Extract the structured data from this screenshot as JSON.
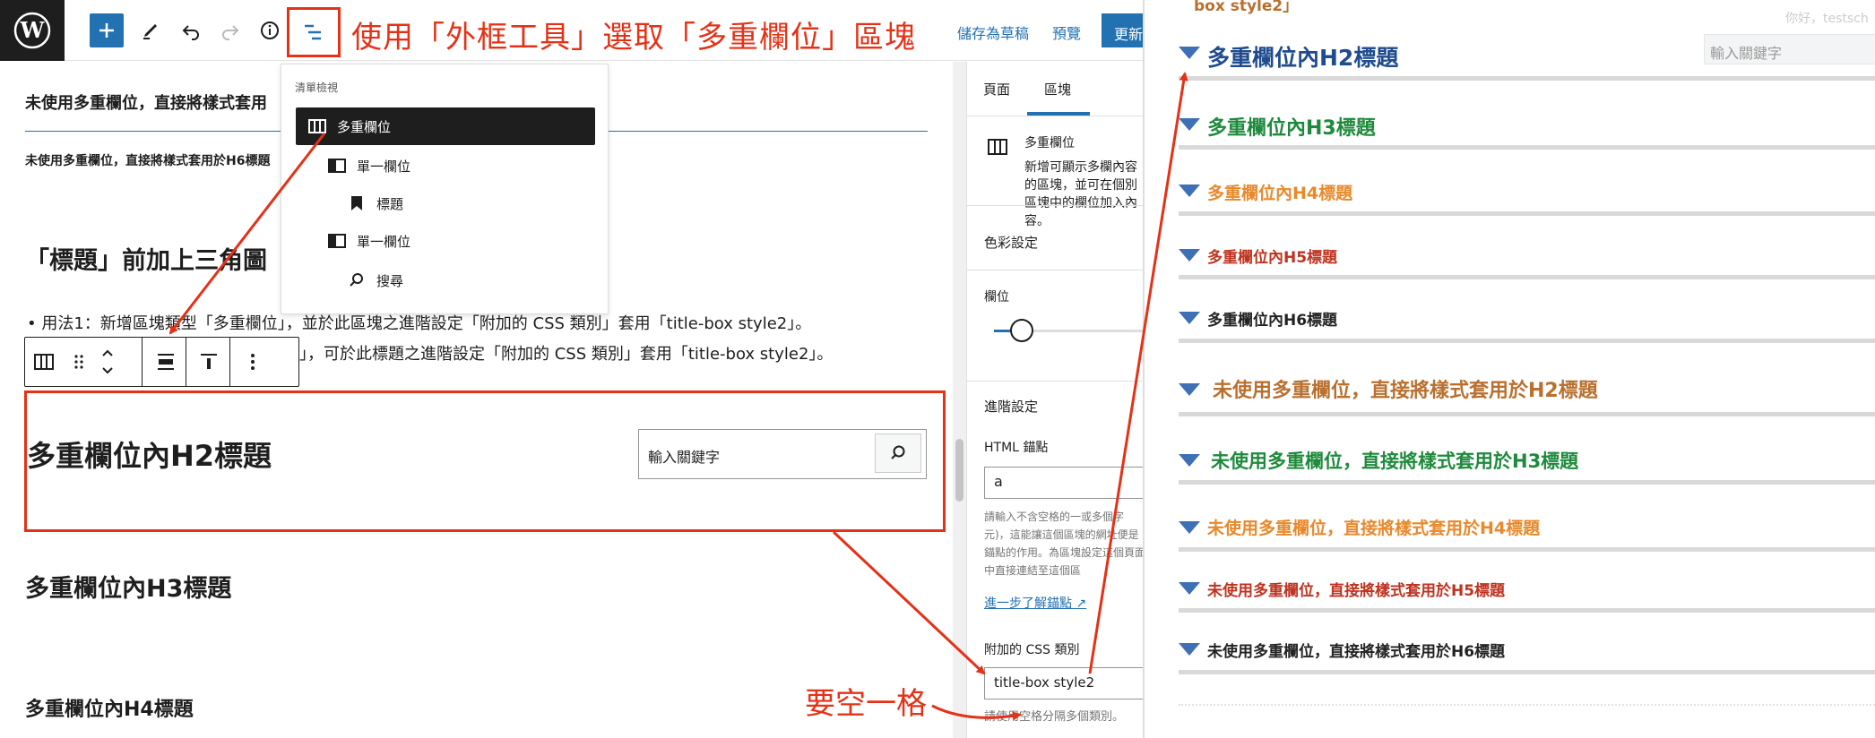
{
  "toolbar": {
    "save_draft": "儲存為草稿",
    "preview": "預覽",
    "update": "更新"
  },
  "annotations": {
    "title": "使用「外框工具」選取「多重欄位」區塊",
    "space_note": "要空一格"
  },
  "list_view": {
    "title": "清單檢視",
    "items": [
      {
        "label": "多重欄位",
        "active": true
      },
      {
        "label": "單一欄位"
      },
      {
        "label": "標題"
      },
      {
        "label": "單一欄位"
      },
      {
        "label": "搜尋"
      }
    ]
  },
  "canvas": {
    "heading_top": "未使用多重欄位，直接將樣式套用",
    "heading_small": "未使用多重欄位，直接將樣式套用於H6標題",
    "section_heading": "「標題」前加上三角圖",
    "bullet1": "用法1：新增區塊類型「多重欄位」，並於此區塊之進階設定「附加的 CSS 類別」套用「title-box style2」。",
    "bullet2": "」，可於此標題之進階設定「附加的 CSS 類別」套用「title-box style2」。",
    "block_h2": "多重欄位內H2標題",
    "search_placeholder": "輸入關鍵字",
    "block_h3": "多重欄位內H3標題",
    "block_h4": "多重欄位內H4標題"
  },
  "sidebar": {
    "tab_page": "頁面",
    "tab_block": "區塊",
    "block_name": "多重欄位",
    "block_desc": "新增可顯示多欄內容的區塊，並可在個別區塊中的欄位加入內容。",
    "color_settings": "色彩設定",
    "columns_label": "欄位",
    "advanced": "進階設定",
    "html_anchor_label": "HTML 錨點",
    "html_anchor_value": "a",
    "anchor_help": "請輸入不含空格的一或多個字元)，這能讓這個區塊的網址便是錨點的作用。為區塊設定這個頁面中直接連結至這個區",
    "learn_more": "進一步了解錨點",
    "css_class_label": "附加的 CSS 類別",
    "css_class_value": "title-box style2",
    "css_class_help": "請使用空格分隔多個類別。"
  },
  "preview": {
    "top_cut": "box style2」",
    "greeting": "你好，testsch",
    "search_placeholder": "輸入關鍵字",
    "headings": [
      {
        "text": "多重欄位內H2標題",
        "color": "#1f4b8f"
      },
      {
        "text": "多重欄位內H3標題",
        "color": "#1e8a3c"
      },
      {
        "text": "多重欄位內H4標題",
        "color": "#e8892b"
      },
      {
        "text": "多重欄位內H5標題",
        "color": "#c0321f"
      },
      {
        "text": "多重欄位內H6標題",
        "color": "#222222"
      },
      {
        "text": "未使用多重欄位，直接將樣式套用於H2標題",
        "color": "#b9702f"
      },
      {
        "text": "未使用多重欄位，直接將樣式套用於H3標題",
        "color": "#1e8a3c"
      },
      {
        "text": "未使用多重欄位，直接將樣式套用於H4標題",
        "color": "#e8892b"
      },
      {
        "text": "未使用多重欄位，直接將樣式套用於H5標題",
        "color": "#c0321f"
      },
      {
        "text": "未使用多重欄位，直接將樣式套用於H6標題",
        "color": "#222222"
      }
    ]
  },
  "colors": {
    "accent_blue": "#2271b1",
    "annotation_red": "#e53116",
    "triangle_blue": "#3f6fb5"
  }
}
